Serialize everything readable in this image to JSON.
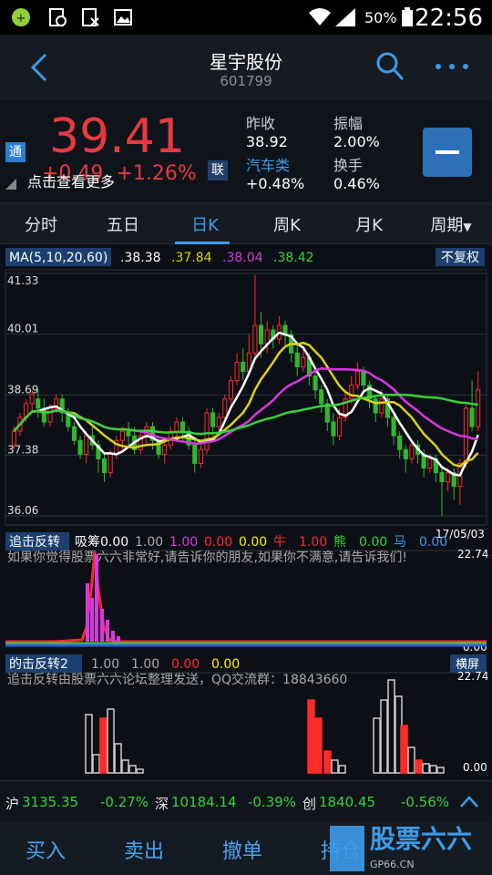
{
  "status": {
    "time": "22:56",
    "battery": "50%"
  },
  "header": {
    "title": "星宇股份",
    "code": "601799"
  },
  "quote": {
    "price": "39.41",
    "change": "+0.49",
    "change_pct": "+1.26%",
    "more": "点击查看更多",
    "tag_left": "通",
    "tag_mid": "联",
    "labels": {
      "prev_close": "昨收",
      "amplitude": "振幅",
      "sector": "汽车类",
      "turnover": "换手"
    },
    "values": {
      "prev_close": "38.92",
      "amplitude": "2.00%",
      "sector": "+0.48%",
      "turnover": "0.46%"
    }
  },
  "tabs": [
    "分时",
    "五日",
    "日K",
    "周K",
    "月K",
    "周期"
  ],
  "chart": {
    "ma_label": "MA(5,10,20,60)",
    "ma_values": [
      ".38.38",
      ".37.84",
      ".38.04",
      ".38.42"
    ],
    "ma_colors": [
      "#ffffff",
      "#d8d01c",
      "#d838e0",
      "#3ccf3c"
    ],
    "fuquan": "不复权",
    "price_ticks": [
      "41.33",
      "40.01",
      "38.69",
      "37.38",
      "36.06"
    ],
    "date": "17/05/03",
    "ind1": {
      "name": "追击反转",
      "items": [
        "吸筹",
        "0.00",
        "1.00",
        "1.00",
        "0.00",
        "0.00",
        "牛",
        "1.00",
        "熊",
        "0.00",
        "马",
        "0.00"
      ],
      "text": "如果你觉得股票六六非常好,请告诉你的朋友,如果你不满意,请告诉我们!",
      "max": "22.74",
      "min": "0.00"
    },
    "ind2": {
      "name": "的击反转2",
      "items": [
        "1.00",
        "1.00",
        "0.00",
        "0.00"
      ],
      "hs": "横屏",
      "text": "追击反转由股票六六论坛整理发送，QQ交流群：18843660",
      "max": "22.74",
      "min": "0.00"
    }
  },
  "chart_data": {
    "type": "candlestick",
    "ylim": [
      36.06,
      41.33
    ],
    "candles": [
      [
        37.6,
        37.9,
        37.5,
        38.0
      ],
      [
        37.9,
        38.2,
        37.8,
        38.3
      ],
      [
        38.2,
        38.5,
        38.1,
        38.6
      ],
      [
        38.5,
        38.7,
        38.3,
        38.8
      ],
      [
        38.6,
        38.4,
        38.2,
        38.8
      ],
      [
        38.4,
        38.1,
        38.0,
        38.6
      ],
      [
        38.1,
        38.4,
        38.0,
        38.5
      ],
      [
        38.4,
        38.6,
        38.3,
        38.7
      ],
      [
        38.6,
        38.3,
        38.1,
        38.7
      ],
      [
        38.3,
        38.0,
        37.9,
        38.4
      ],
      [
        38.0,
        37.7,
        37.6,
        38.1
      ],
      [
        37.7,
        37.4,
        37.3,
        37.8
      ],
      [
        37.4,
        37.8,
        37.2,
        37.9
      ],
      [
        37.8,
        37.6,
        37.5,
        38.0
      ],
      [
        37.6,
        37.3,
        37.0,
        37.7
      ],
      [
        37.3,
        37.0,
        36.8,
        37.4
      ],
      [
        37.0,
        37.4,
        36.9,
        37.5
      ],
      [
        37.4,
        37.7,
        37.3,
        37.8
      ],
      [
        37.7,
        37.9,
        37.5,
        38.0
      ],
      [
        37.9,
        37.8,
        37.6,
        38.1
      ],
      [
        37.8,
        37.5,
        37.4,
        38.0
      ],
      [
        37.5,
        37.8,
        37.4,
        37.9
      ],
      [
        37.8,
        38.0,
        37.6,
        38.1
      ],
      [
        38.0,
        37.7,
        37.5,
        38.1
      ],
      [
        37.7,
        37.4,
        37.3,
        37.8
      ],
      [
        37.4,
        37.6,
        37.2,
        37.7
      ],
      [
        37.6,
        37.9,
        37.5,
        38.0
      ],
      [
        37.9,
        38.1,
        37.8,
        38.2
      ],
      [
        38.1,
        37.9,
        37.7,
        38.2
      ],
      [
        37.9,
        37.6,
        37.5,
        38.0
      ],
      [
        37.6,
        37.2,
        37.0,
        37.7
      ],
      [
        37.2,
        37.5,
        37.1,
        37.6
      ],
      [
        37.5,
        38.3,
        37.4,
        38.4
      ],
      [
        38.3,
        38.0,
        37.8,
        38.4
      ],
      [
        38.0,
        38.2,
        37.9,
        38.3
      ],
      [
        38.2,
        38.6,
        38.1,
        38.7
      ],
      [
        38.6,
        39.0,
        38.5,
        39.1
      ],
      [
        39.0,
        39.4,
        38.9,
        39.6
      ],
      [
        39.4,
        39.2,
        39.0,
        39.7
      ],
      [
        39.2,
        39.6,
        39.1,
        40.0
      ],
      [
        39.6,
        40.2,
        39.5,
        41.3
      ],
      [
        40.2,
        39.8,
        39.5,
        40.5
      ],
      [
        39.8,
        40.1,
        39.6,
        40.3
      ],
      [
        40.1,
        39.9,
        39.7,
        40.2
      ],
      [
        39.9,
        40.2,
        39.8,
        40.4
      ],
      [
        40.2,
        40.0,
        39.7,
        40.3
      ],
      [
        40.0,
        39.6,
        39.4,
        40.1
      ],
      [
        39.6,
        39.3,
        39.1,
        39.8
      ],
      [
        39.3,
        39.5,
        39.2,
        39.7
      ],
      [
        39.5,
        39.1,
        38.9,
        39.6
      ],
      [
        39.1,
        38.8,
        38.6,
        39.2
      ],
      [
        38.8,
        38.5,
        38.3,
        38.9
      ],
      [
        38.5,
        38.1,
        37.9,
        38.6
      ],
      [
        38.1,
        37.8,
        37.6,
        38.3
      ],
      [
        37.8,
        38.2,
        37.7,
        38.4
      ],
      [
        38.2,
        38.6,
        38.1,
        38.8
      ],
      [
        38.6,
        38.9,
        38.5,
        39.1
      ],
      [
        38.9,
        39.2,
        38.8,
        39.4
      ],
      [
        39.2,
        38.9,
        38.7,
        39.3
      ],
      [
        38.9,
        38.6,
        38.4,
        39.0
      ],
      [
        38.6,
        38.3,
        38.1,
        38.7
      ],
      [
        38.3,
        38.6,
        38.2,
        38.8
      ],
      [
        38.6,
        38.2,
        38.0,
        38.7
      ],
      [
        38.2,
        37.8,
        37.6,
        38.3
      ],
      [
        37.8,
        37.5,
        37.3,
        37.9
      ],
      [
        37.5,
        37.3,
        37.0,
        37.6
      ],
      [
        37.3,
        37.6,
        37.2,
        37.7
      ],
      [
        37.6,
        37.4,
        37.2,
        37.7
      ],
      [
        37.4,
        37.1,
        36.9,
        37.5
      ],
      [
        37.1,
        37.3,
        37.0,
        37.4
      ],
      [
        37.3,
        37.0,
        36.8,
        37.4
      ],
      [
        37.0,
        36.8,
        36.06,
        37.1
      ],
      [
        36.8,
        37.0,
        36.6,
        37.1
      ],
      [
        37.0,
        36.7,
        36.4,
        37.1
      ],
      [
        36.7,
        37.2,
        36.3,
        37.3
      ],
      [
        37.2,
        38.4,
        37.1,
        38.5
      ],
      [
        38.4,
        38.0,
        37.9,
        39.0
      ],
      [
        38.0,
        38.8,
        37.9,
        39.2
      ]
    ]
  },
  "indices": [
    {
      "label": "沪",
      "value": "3135.35",
      "pct": "-0.27%"
    },
    {
      "label": "深",
      "value": "10184.14",
      "pct": "-0.39%"
    },
    {
      "label": "创",
      "value": "1840.45",
      "pct": "-0.56%"
    }
  ],
  "actions": [
    "买入",
    "卖出",
    "撤单",
    "持仓"
  ],
  "watermark": {
    "text": "股票六六",
    "sub": "GP66.CN"
  }
}
